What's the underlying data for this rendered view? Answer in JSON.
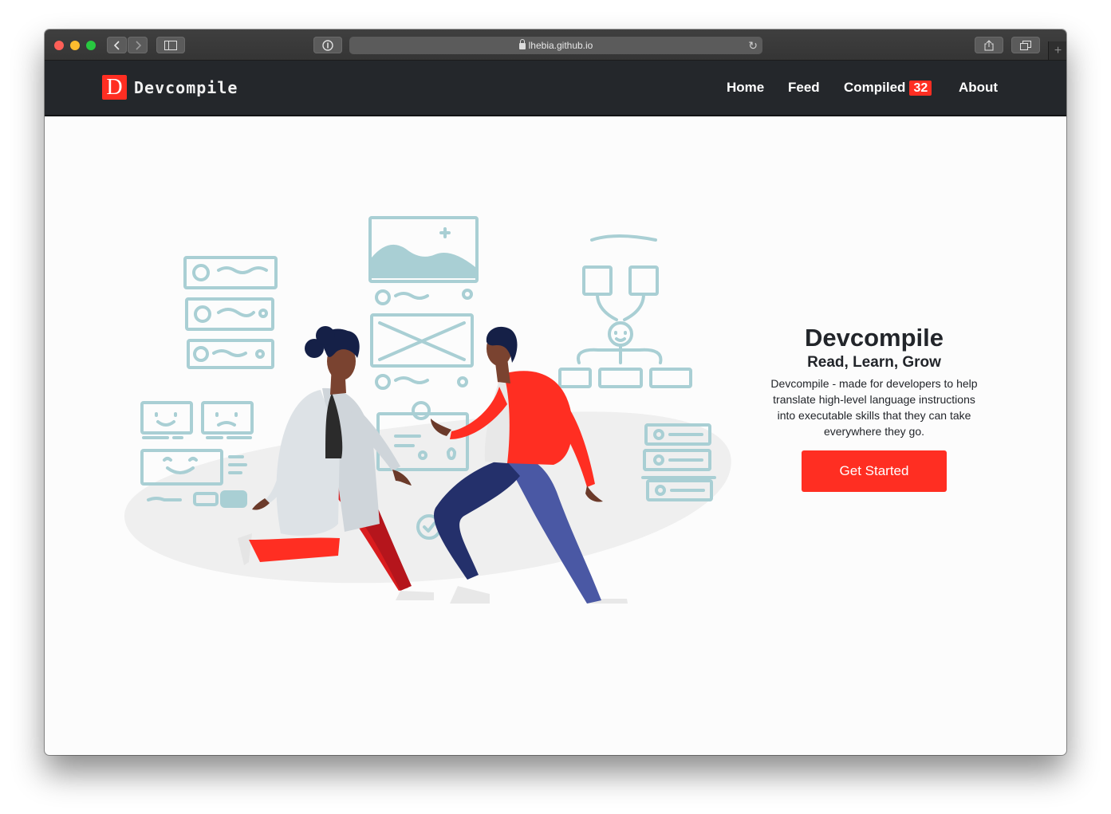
{
  "browser": {
    "url": "lhebia.github.io",
    "new_tab_symbol": "+"
  },
  "navbar": {
    "logo_letter": "D",
    "brand": "Devcompile",
    "links": [
      {
        "label": "Home"
      },
      {
        "label": "Feed"
      },
      {
        "label": "Compiled",
        "badge": "32"
      },
      {
        "label": "About"
      }
    ]
  },
  "hero": {
    "title": "Devcompile",
    "subtitle": "Read, Learn, Grow",
    "description": "Devcompile - made for developers to help translate high-level language instructions into executable skills that they can take everywhere they go.",
    "cta_label": "Get Started"
  },
  "colors": {
    "accent": "#ff2e22",
    "navbar_bg": "#24272b",
    "sketch": "#a9cfd4"
  }
}
